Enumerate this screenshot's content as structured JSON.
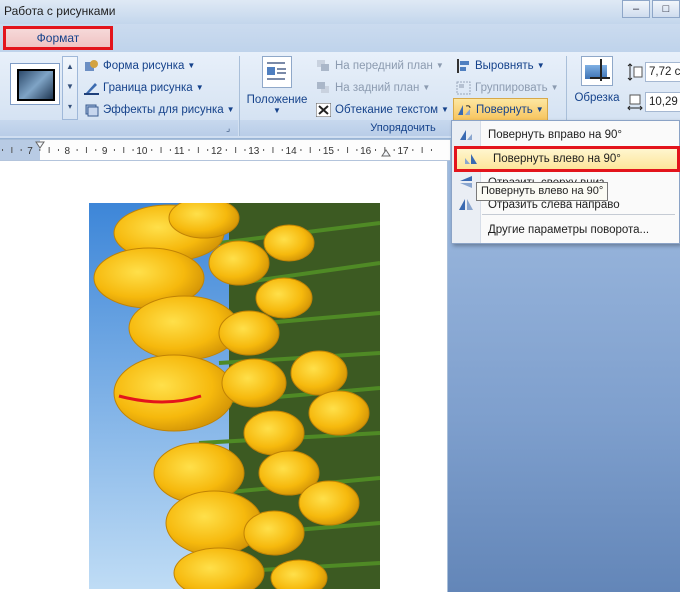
{
  "window": {
    "context_title": "Работа с рисунками",
    "min": "–",
    "max": "□"
  },
  "tabs": {
    "format": "Формат"
  },
  "ribbon": {
    "picture_styles": {
      "shape": "Форма рисунка",
      "border": "Граница рисунка",
      "effects": "Эффекты для рисунка"
    },
    "arrange": {
      "position": "Положение",
      "bring_front": "На передний план",
      "send_back": "На задний план",
      "text_wrap": "Обтекание текстом",
      "align": "Выровнять",
      "group": "Группировать",
      "rotate": "Повернуть",
      "group_label": "Упорядочить"
    },
    "size": {
      "crop": "Обрезка",
      "height": "7,72 c",
      "width": "10,29"
    }
  },
  "ruler": {
    "labels": [
      "7",
      "8",
      "9",
      "10",
      "11",
      "12",
      "13",
      "14",
      "15",
      "16",
      "17"
    ]
  },
  "rotate_menu": {
    "items": [
      "Повернуть вправо на 90°",
      "Повернуть влево на 90°",
      "Отразить сверху вниз",
      "Отразить слева направо",
      "Другие параметры поворота..."
    ],
    "tooltip": "Повернуть влево на 90°"
  }
}
